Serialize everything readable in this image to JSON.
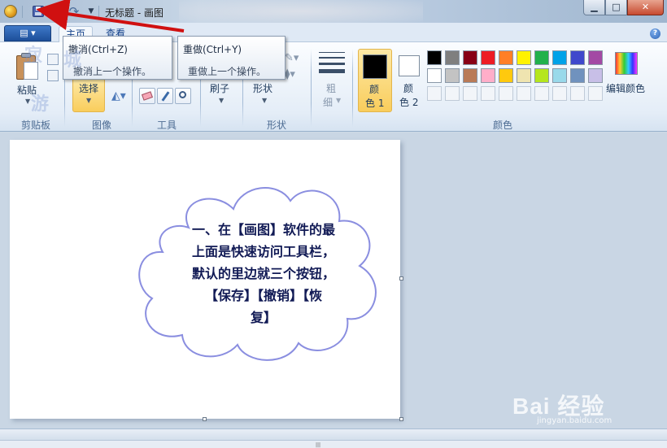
{
  "titlebar": {
    "title": "无标题 - 画图",
    "min": "▭",
    "max": "☐",
    "close": "✕"
  },
  "tabs": {
    "file": "▤ ▾",
    "home": "主页",
    "view": "查看",
    "help": "?"
  },
  "ribbon": {
    "paste": "粘贴",
    "select": "选择",
    "brush": "刷子",
    "shapes": "形状",
    "size_a": "粗",
    "size_b": "细",
    "color1_a": "颜",
    "color1_b": "色 1",
    "color2_a": "颜",
    "color2_b": "色 2",
    "edit_colors": "编辑颜色",
    "groups": {
      "clipboard": "剪贴板",
      "image": "图像",
      "tools": "工具",
      "shapes": "形状",
      "colors": "颜色"
    }
  },
  "tooltips": {
    "undo_title": "撤消(Ctrl+Z)",
    "undo_desc": "撤消上一个操作。",
    "redo_title": "重做(Ctrl+Y)",
    "redo_desc": "重做上一个操作。"
  },
  "palette": {
    "colors": [
      "#000000",
      "#7f7f7f",
      "#880015",
      "#ed1c24",
      "#ff7f27",
      "#fff200",
      "#22b14c",
      "#00a2e8",
      "#3f48cc",
      "#a349a4",
      "#ffffff",
      "#c3c3c3",
      "#b97a57",
      "#ffaec9",
      "#ffc90e",
      "#efe4b0",
      "#b5e61d",
      "#99d9ea",
      "#7092be",
      "#c8bfe7"
    ],
    "color1": "#000000",
    "color2": "#ffffff"
  },
  "canvas": {
    "callout_lines": [
      "一、在【画图】软件的最",
      "上面是快速访问工具栏，",
      "默认的里边就三个按钮，",
      "【保存】【撤销】【恢",
      "复】"
    ]
  },
  "watermark": {
    "brand": "Bai 经验",
    "url": "jingyan.baidu.com"
  }
}
